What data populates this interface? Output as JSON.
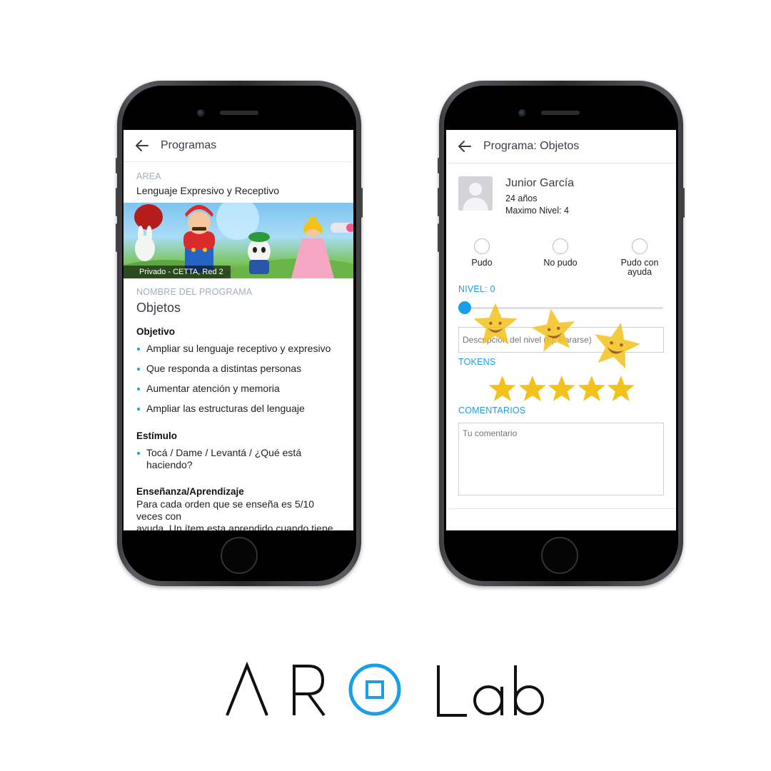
{
  "brand": {
    "logo_text": "AR Lab",
    "accent_color": "#1a9ee8"
  },
  "left_screen": {
    "appbar": {
      "back_icon": "arrow-left-icon",
      "title": "Programas"
    },
    "area": {
      "label": "AREA",
      "value": "Lenguaje Expresivo y Receptivo"
    },
    "banner": {
      "caption": "Privado - CETTA, Red 2"
    },
    "program": {
      "label": "NOMBRE DEL PROGRAMA",
      "name": "Objetos"
    },
    "objetivo": {
      "heading": "Objetivo",
      "items": [
        "Ampliar su lenguaje receptivo y expresivo",
        "Que responda a distintas personas",
        "Aumentar atención y memoria",
        "Ampliar las estructuras del lenguaje"
      ]
    },
    "estimulo": {
      "heading": "Estímulo",
      "items": [
        "Tocá / Dame / Levantá / ¿Qué está haciendo?"
      ]
    },
    "ensenanza": {
      "heading": "Enseñanza/Aprendizaje",
      "line1": "Para cada orden que se enseña es 5/10",
      "line2": "veces con",
      "line3": "ayuda. Un ítem esta aprendido cuando tiene"
    }
  },
  "right_screen": {
    "appbar": {
      "back_icon": "arrow-left-icon",
      "title": "Programa: Objetos"
    },
    "patient": {
      "avatar_icon": "user-placeholder-icon",
      "name": "Junior García",
      "age": "24 años",
      "max_level": "Maximo Nivel: 4"
    },
    "outcome_options": [
      "Pudo",
      "No pudo",
      "Pudo con ayuda"
    ],
    "level": {
      "label": "NIVEL: 0",
      "value": 0
    },
    "level_description": {
      "placeholder": "Descripción del nivel (Ej. Pararse)"
    },
    "tokens": {
      "label": "TOKENS",
      "count": 5,
      "icon": "star-icon",
      "color": "#f2c21b"
    },
    "comments": {
      "label": "COMENTARIOS",
      "placeholder": "Tu comentario"
    }
  }
}
